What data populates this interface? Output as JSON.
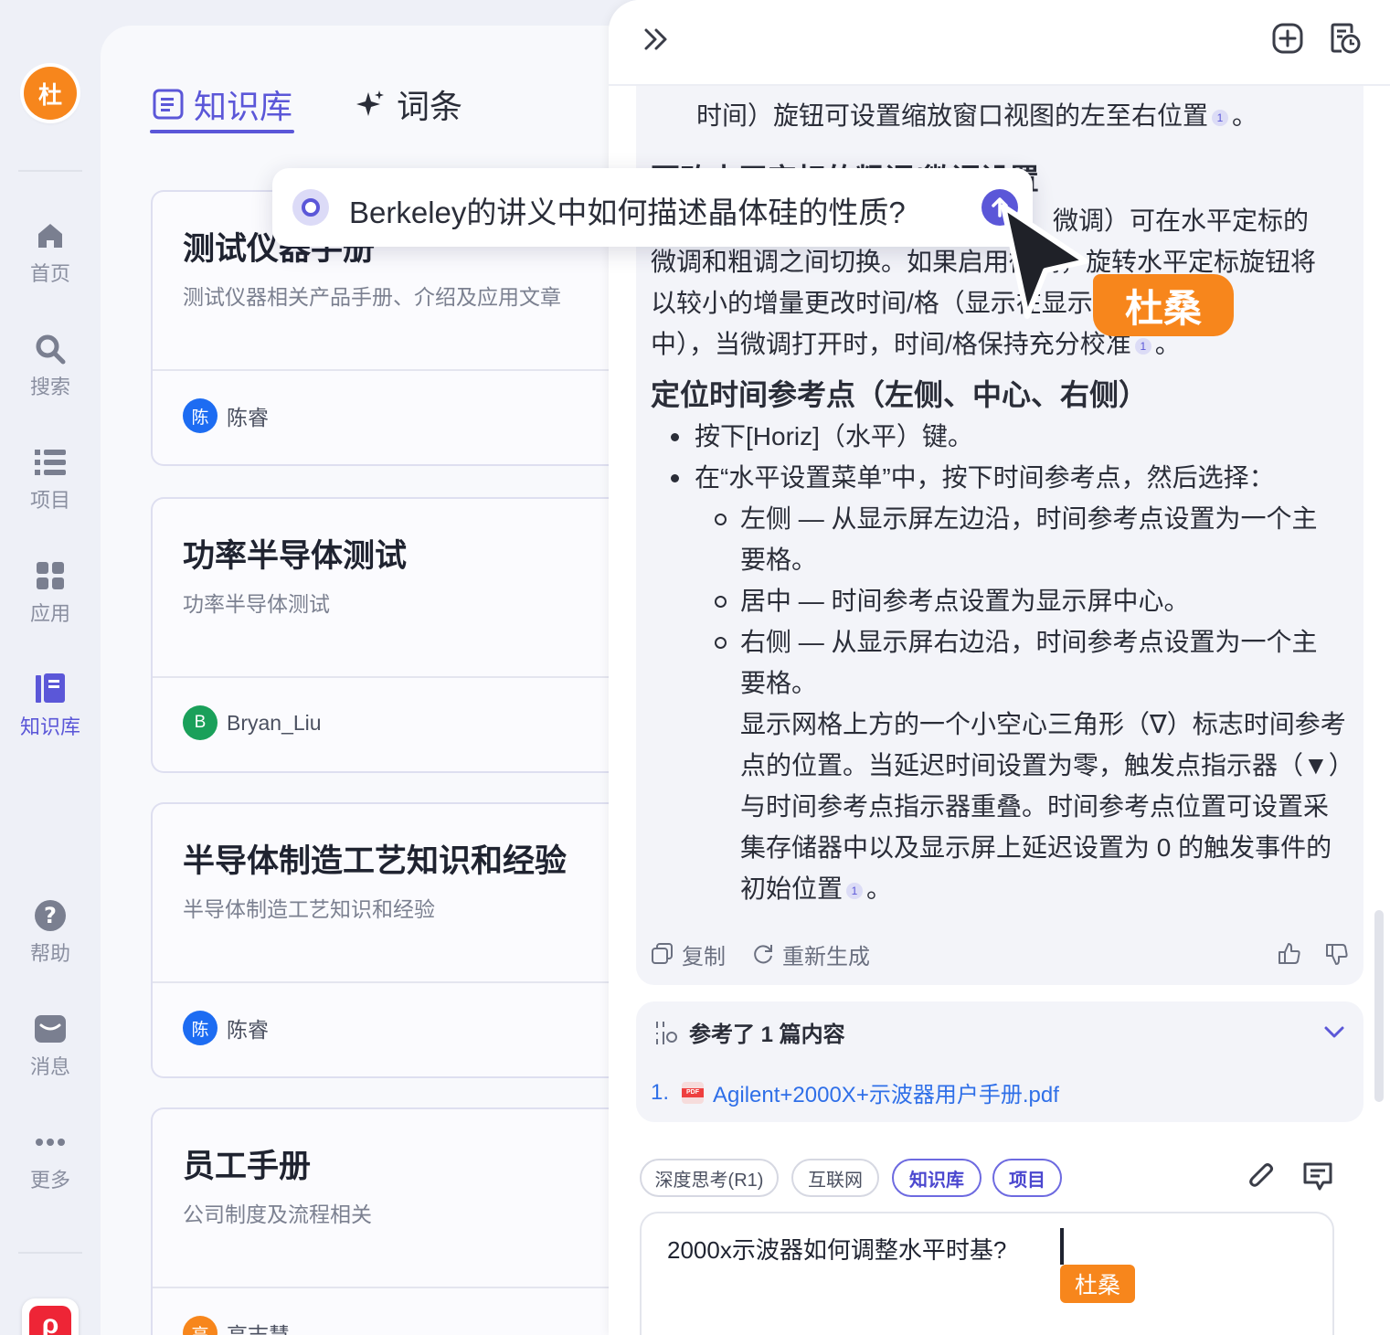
{
  "user": {
    "avatar": "杜"
  },
  "nav": [
    {
      "label": "首页",
      "icon": "home-icon"
    },
    {
      "label": "搜索",
      "icon": "search-icon"
    },
    {
      "label": "项目",
      "icon": "list-icon"
    },
    {
      "label": "应用",
      "icon": "apps-grid-icon"
    },
    {
      "label": "知识库",
      "icon": "book-icon",
      "active": true
    },
    {
      "label": "帮助",
      "icon": "help-icon"
    },
    {
      "label": "消息",
      "icon": "message-icon"
    },
    {
      "label": "更多",
      "icon": "more-icon"
    }
  ],
  "tabs": {
    "knowledge": "知识库",
    "terms": "词条"
  },
  "cards": [
    {
      "title": "测试仪器手册",
      "desc": "测试仪器相关产品手册、介绍及应用文章",
      "owner": "陈睿",
      "owner_initial": "陈",
      "owner_color": "#1d6cf2"
    },
    {
      "title": "功率半导体测试",
      "desc": "功率半导体测试",
      "owner": "Bryan_Liu",
      "owner_initial": "B",
      "owner_color": "#1aa05a"
    },
    {
      "title": "半导体制造工艺知识和经验",
      "desc": "半导体制造工艺知识和经验",
      "owner": "陈睿",
      "owner_initial": "陈",
      "owner_color": "#1d6cf2"
    },
    {
      "title": "员工手册",
      "desc": "公司制度及流程相关",
      "owner": "高志慧",
      "owner_initial": "高",
      "owner_color": "#f7861c"
    }
  ],
  "popup": {
    "query": "Berkeley的讲义中如何描述晶体硅的性质?"
  },
  "cursor_tag": "杜桑",
  "answer": {
    "line_top": "时间）旋钮可设置缩放窗口视图的左至右位置",
    "section1_title": "更改水平定标的粗调/微调设置",
    "p1": [
      "微调）可在水平定标的",
      "微调和粗调之间切换。如果启用微调，旋转水平定标旋钮将",
      "以较小的增量更改时间/格（显示在显示屏的状态行",
      "中），当微调打开时，时间/格保持充分校准"
    ],
    "section2_title": "定位时间参考点（左侧、中心、右侧）",
    "b1": "按下[Horiz]（水平）键。",
    "b2": "在“水平设置菜单”中，按下时间参考点，然后选择：",
    "s1a": "左侧 — 从显示屏左边沿，时间参考点设置为一个主",
    "s1b": "要格。",
    "s2": "居中 — 时间参考点设置为显示屏中心。",
    "s3a": "右侧 — 从显示屏右边沿，时间参考点设置为一个主",
    "s3b": "要格。",
    "note": [
      "显示网格上方的一个小空心三角形（∇）标志时间参考",
      "点的位置。当延迟时间设置为零，触发点指示器（▼）",
      "与时间参考点指示器重叠。时间参考点位置可设置采",
      "集存储器中以及显示屏上延迟设置为 0 的触发事件的",
      "初始位置"
    ],
    "cite": "1",
    "copy": "复制",
    "regenerate": "重新生成"
  },
  "refs": {
    "title": "参考了 1 篇内容",
    "num": "1.",
    "file": "Agilent+2000X+示波器用户手册.pdf",
    "pdf_badge": "PDF"
  },
  "chips": [
    "深度思考(R1)",
    "互联网",
    "知识库",
    "项目"
  ],
  "input": {
    "value": "2000x示波器如何调整水平时基?",
    "cursor_tag": "杜桑"
  },
  "colors": {
    "accent": "#5b57d8",
    "orange": "#f7861c"
  }
}
